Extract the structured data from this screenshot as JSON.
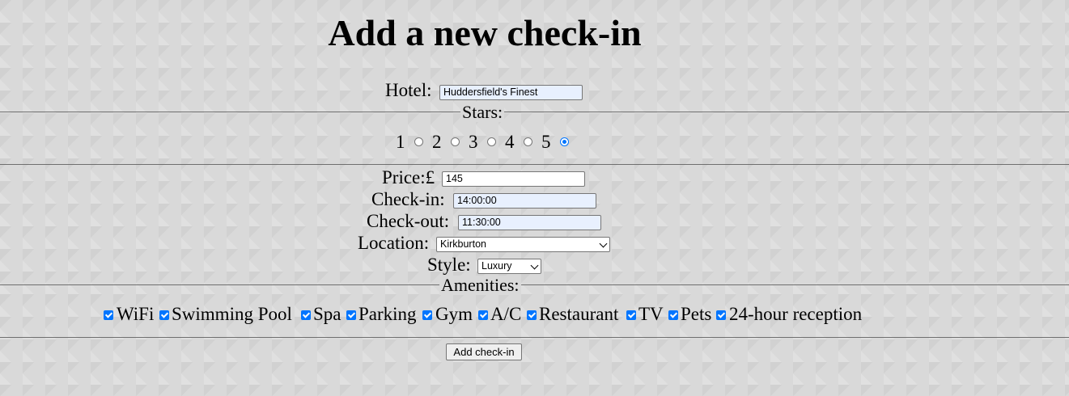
{
  "title": "Add a new check-in",
  "hotel": {
    "label": "Hotel:",
    "value": "Huddersfield's Finest"
  },
  "stars": {
    "legend": "Stars:",
    "options": [
      "1",
      "2",
      "3",
      "4",
      "5"
    ],
    "selected": "5"
  },
  "price": {
    "label": "Price:£",
    "value": "145"
  },
  "checkin": {
    "label": "Check-in:",
    "value": "14:00:00"
  },
  "checkout": {
    "label": "Check-out:",
    "value": "11:30:00"
  },
  "location": {
    "label": "Location:",
    "value": "Kirkburton"
  },
  "style": {
    "label": "Style:",
    "value": "Luxury"
  },
  "amenities": {
    "legend": "Amenities:",
    "items": [
      "WiFi",
      "Swimming Pool",
      "Spa",
      "Parking",
      "Gym",
      "A/C",
      "Restaurant",
      "TV",
      "Pets",
      "24-hour reception"
    ],
    "all_checked": true
  },
  "submit_label": "Add check-in",
  "colors": {
    "accent": "#0075ff",
    "autofill": "#e8f0fe",
    "background": "#d9d9d9"
  }
}
